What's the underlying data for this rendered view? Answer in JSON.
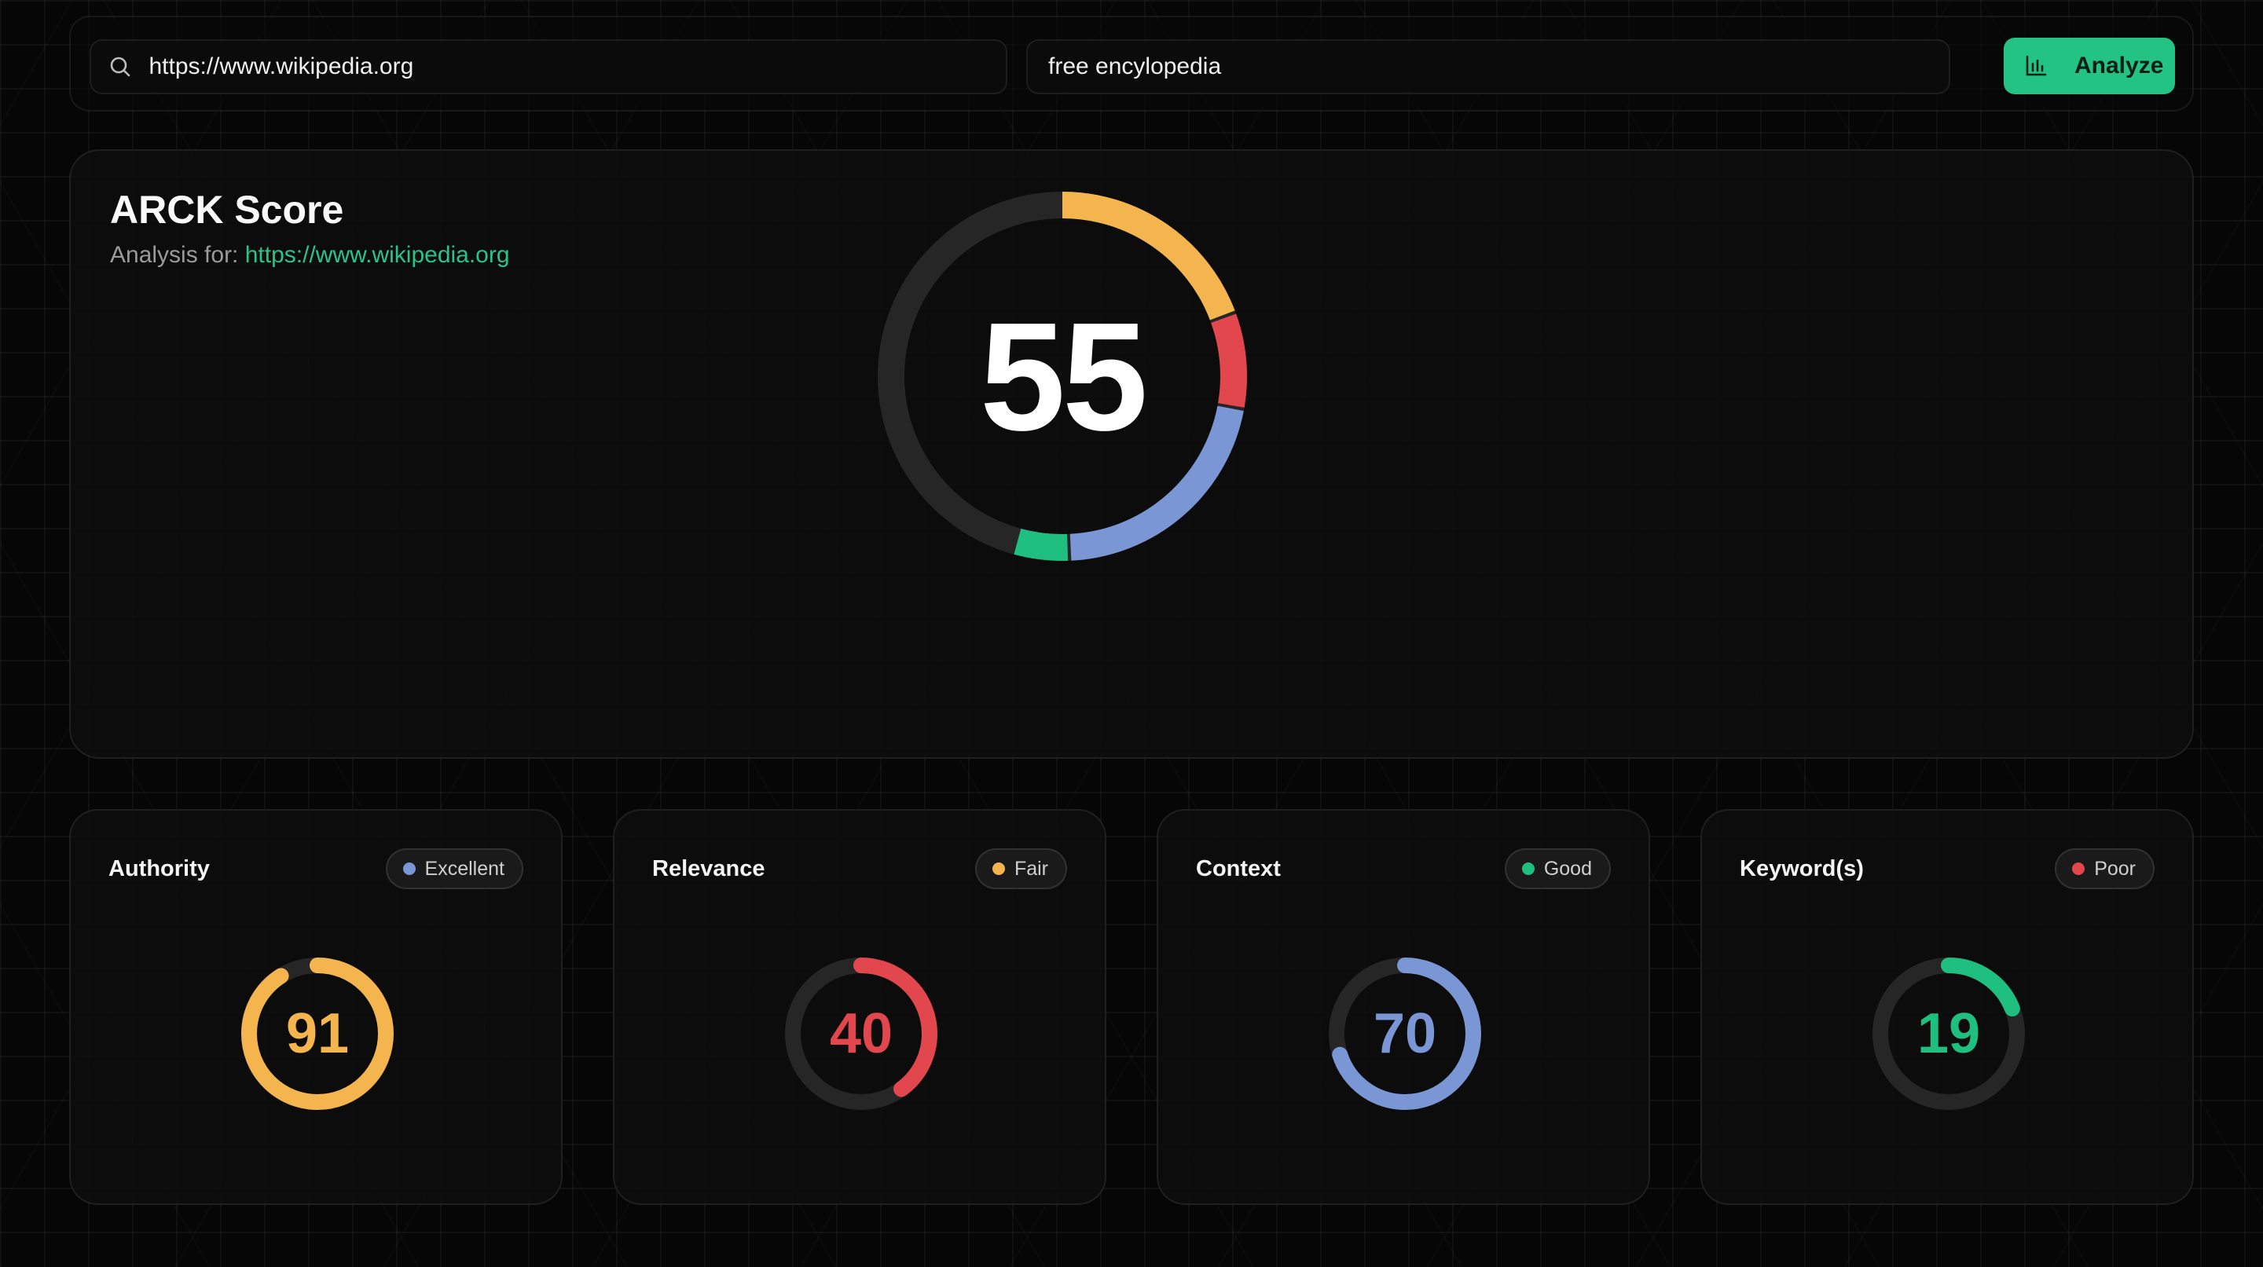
{
  "search": {
    "url_value": "https://www.wikipedia.org",
    "keyword_value": "free encylopedia",
    "analyze_label": "Analyze"
  },
  "colors": {
    "accent": "#23c383",
    "yellow": "#f4b54e",
    "red": "#e2474d",
    "blue": "#7a96d4",
    "green": "#1fbf7f",
    "track": "#262626"
  },
  "score": {
    "title": "ARCK Score",
    "subtitle_prefix": "Analysis for:",
    "subtitle_link": "https://www.wikipedia.org",
    "value": "55",
    "segments": [
      {
        "color": "#f4b54e",
        "fraction": 0.195
      },
      {
        "color": "#e2474d",
        "fraction": 0.085
      },
      {
        "color": "#7a96d4",
        "fraction": 0.215
      },
      {
        "color": "#1fbf7f",
        "fraction": 0.05
      }
    ]
  },
  "metrics": [
    {
      "title": "Authority",
      "status": "Excellent",
      "status_color": "#7a96d4",
      "value": "91",
      "color": "#f4b54e",
      "fraction": 0.91
    },
    {
      "title": "Relevance",
      "status": "Fair",
      "status_color": "#f4b54e",
      "value": "40",
      "color": "#e2474d",
      "fraction": 0.4
    },
    {
      "title": "Context",
      "status": "Good",
      "status_color": "#1fbf7f",
      "value": "70",
      "color": "#7a96d4",
      "fraction": 0.7
    },
    {
      "title": "Keyword(s)",
      "status": "Poor",
      "status_color": "#e2474d",
      "value": "19",
      "color": "#1fbf7f",
      "fraction": 0.19
    }
  ]
}
